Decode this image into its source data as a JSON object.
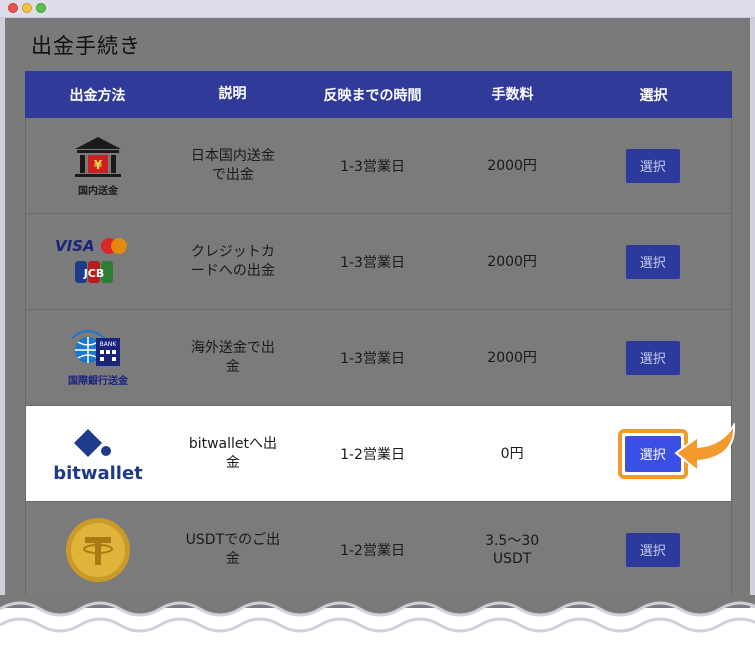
{
  "page": {
    "title": "出金手続き"
  },
  "table": {
    "headers": [
      "出金方法",
      "説明",
      "反映までの時間",
      "手数料",
      "選択"
    ],
    "rows": [
      {
        "method_label": "国内送金",
        "description": "日本国内送金\nで出金",
        "time": "1-3営業日",
        "fee": "2000円",
        "button": "選択",
        "icon": "bank-icon"
      },
      {
        "method_label": "VISA / Mastercard / JCB",
        "description": "クレジットカ\nードへの出金",
        "time": "1-3営業日",
        "fee": "2000円",
        "button": "選択",
        "icon": "card-brands-icon"
      },
      {
        "method_label": "国際銀行送金",
        "description": "海外送金で出\n金",
        "time": "1-3営業日",
        "fee": "2000円",
        "button": "選択",
        "icon": "international-bank-icon"
      },
      {
        "method_label": "bitwallet",
        "description": "bitwalletへ出\n金",
        "time": "1-2営業日",
        "fee": "0円",
        "button": "選択",
        "icon": "bitwallet-logo"
      },
      {
        "method_label": "USDT",
        "description": "USDTでのご出\n金",
        "time": "1-2営業日",
        "fee": "3.5～30\nUSDT",
        "button": "選択",
        "icon": "tether-coin-icon"
      }
    ],
    "brand_text": {
      "visa": "VISA",
      "jcb": "JCB",
      "bitwallet": "bitwallet",
      "bank_sign": "BANK"
    }
  },
  "colors": {
    "header_bg": "#2f3a99",
    "button_bg": "#2c3a9e",
    "active_button_bg": "#3a4fe3",
    "highlight": "#f29a2e"
  }
}
